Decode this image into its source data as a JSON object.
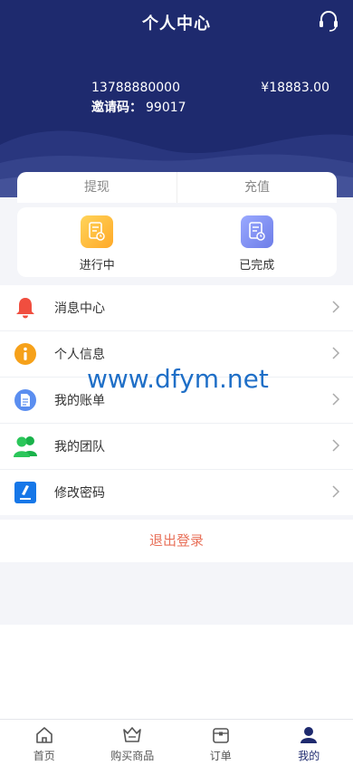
{
  "header": {
    "title": "个人中心",
    "phone": "13788880000",
    "invite_label": "邀请码：",
    "invite_code": "99017",
    "balance": "¥18883.00"
  },
  "tabs": [
    {
      "label": "提现"
    },
    {
      "label": "充值"
    }
  ],
  "orders": [
    {
      "label": "进行中",
      "icon": "order-in-progress-icon"
    },
    {
      "label": "已完成",
      "icon": "order-completed-icon"
    }
  ],
  "menu": [
    {
      "label": "消息中心",
      "icon": "bell-icon"
    },
    {
      "label": "个人信息",
      "icon": "info-icon"
    },
    {
      "label": "我的账单",
      "icon": "bill-icon"
    },
    {
      "label": "我的团队",
      "icon": "team-icon"
    },
    {
      "label": "修改密码",
      "icon": "edit-password-icon"
    }
  ],
  "logout_label": "退出登录",
  "watermark": "www.dfym.net",
  "tabbar": [
    {
      "label": "首页",
      "icon": "home-icon"
    },
    {
      "label": "购买商品",
      "icon": "shop-basket-icon"
    },
    {
      "label": "订单",
      "icon": "orders-icon"
    },
    {
      "label": "我的",
      "icon": "profile-icon",
      "active": true
    }
  ],
  "colors": {
    "header_bg": "#1e2a6e",
    "logout_text": "#e8715a",
    "active_tab": "#1e2a6e"
  }
}
